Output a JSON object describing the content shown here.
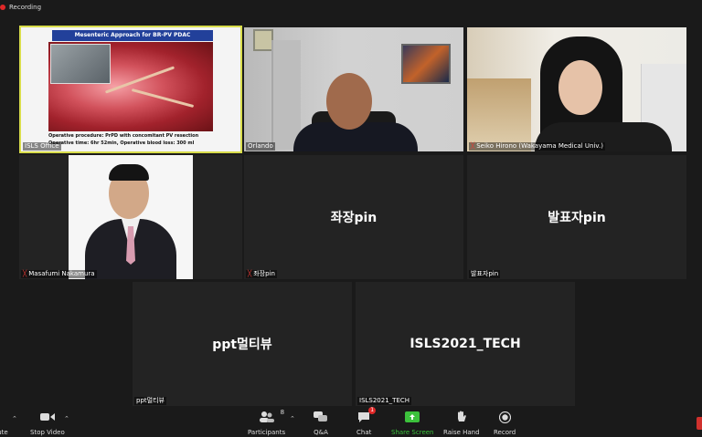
{
  "recording": {
    "label": "Recording"
  },
  "tiles": {
    "slide": {
      "name": "ISLS Office",
      "title": "Mesenteric Approach for BR-PV PDAC",
      "line1": "Operative procedure: PrPD with concomitant PV resection",
      "line2": "Operative time: 6hr 52min,  Operative blood loss: 300 ml"
    },
    "orlando": {
      "name": "Orlando"
    },
    "seiko": {
      "name": "Seiko Hirono (Wakayama Medical Univ.)"
    },
    "masafumi": {
      "name": "Masafumi Nakamura"
    },
    "chair_pin": {
      "center": "좌장pin",
      "name": "좌장pin"
    },
    "presenter_pin": {
      "center": "발표자pin",
      "name": "발표자pin"
    },
    "ppt_multi": {
      "center": "ppt멀티뷰",
      "name": "ppt멀티뷰"
    },
    "isls_tech": {
      "center": "ISLS2021_TECH",
      "name": "ISLS2021_TECH"
    }
  },
  "toolbar": {
    "mute_label": "ute",
    "video_label": "Stop Video",
    "participants_label": "Participants",
    "participants_count": "8",
    "qa_label": "Q&A",
    "chat_label": "Chat",
    "chat_badge": "1",
    "share_label": "Share Screen",
    "raise_label": "Raise Hand",
    "record_label": "Record"
  },
  "colors": {
    "share_green": "#3cc13c",
    "mute_red": "#e53935",
    "active_border": "#d8dc4a"
  }
}
